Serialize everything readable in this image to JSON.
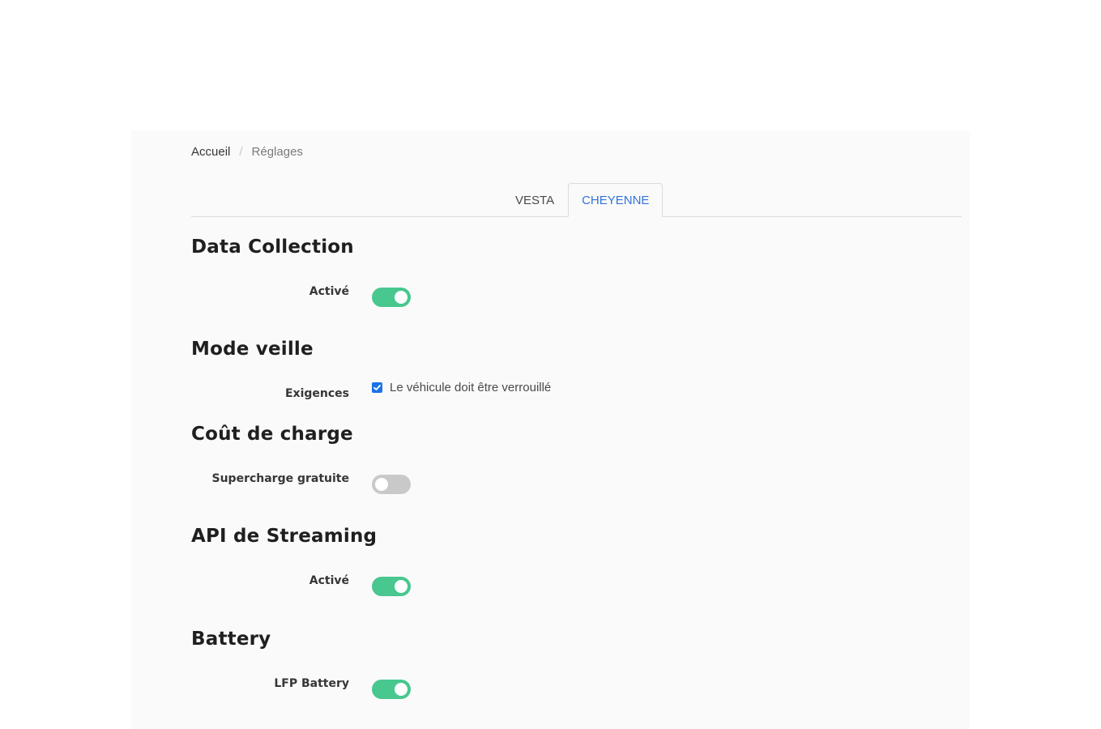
{
  "breadcrumb": {
    "home": "Accueil",
    "separator": "/",
    "current": "Réglages"
  },
  "tabs": [
    {
      "label": "VESTA",
      "active": false
    },
    {
      "label": "CHEYENNE",
      "active": true
    }
  ],
  "sections": {
    "data_collection": {
      "title": "Data Collection",
      "label": "Activé",
      "enabled": true
    },
    "sleep_mode": {
      "title": "Mode veille",
      "label": "Exigences",
      "checkbox_label": "Le véhicule doit être verrouillé",
      "checked": true
    },
    "charge_cost": {
      "title": "Coût de charge",
      "label": "Supercharge gratuite",
      "enabled": false
    },
    "streaming_api": {
      "title": "API de Streaming",
      "label": "Activé",
      "enabled": true
    },
    "battery": {
      "title": "Battery",
      "label": "LFP Battery",
      "enabled": true
    }
  },
  "colors": {
    "toggle_on": "#48c78e",
    "toggle_off": "#c9c9c9",
    "tab_active": "#3273dc",
    "checkbox": "#1a73e8"
  }
}
